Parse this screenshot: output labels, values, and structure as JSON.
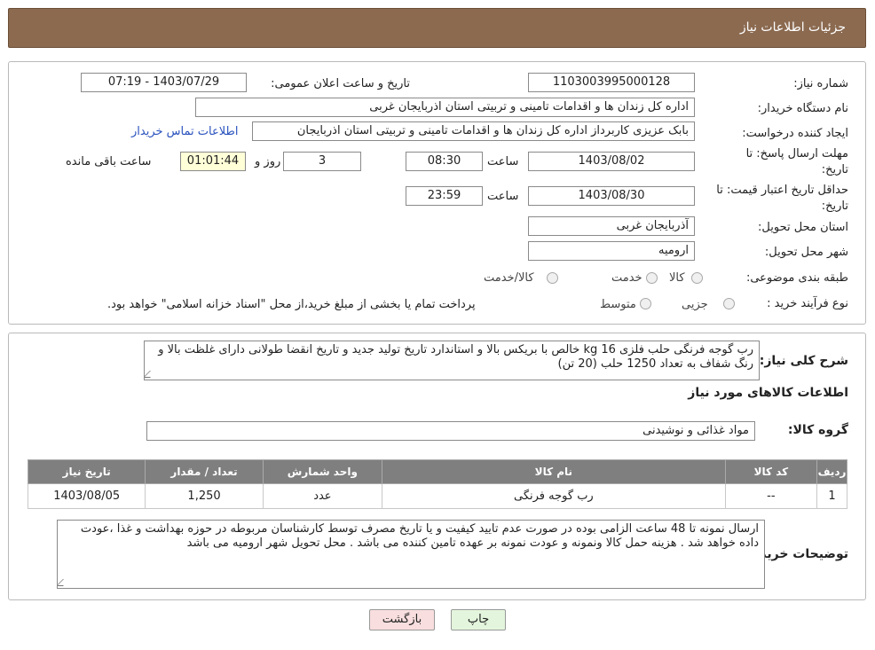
{
  "window": {
    "title": "جزئیات اطلاعات نیاز"
  },
  "form": {
    "need_number_label": "شماره نیاز:",
    "need_number": "1103003995000128",
    "announce_label": "تاریخ و ساعت اعلان عمومی:",
    "announce_value": "1403/07/29 - 07:19",
    "buyer_org_label": "نام دستگاه خریدار:",
    "buyer_org": "اداره کل زندان ها و اقدامات تامینی و تربیتی استان اذربایجان غربی",
    "requester_label": "ایجاد کننده درخواست:",
    "requester": "بابک عزیزی کاربرداز اداره کل زندان ها و اقدامات تامینی و تربیتی استان اذربایجان",
    "contact_link": "اطلاعات تماس خریدار",
    "deadline_label": "مهلت ارسال پاسخ: تا تاریخ:",
    "deadline_date": "1403/08/02",
    "time_label": "ساعت",
    "deadline_time": "08:30",
    "days_value": "3",
    "days_label": "روز و",
    "remaining_time": "01:01:44",
    "remaining_label": "ساعت باقی مانده",
    "validity_label": "حداقل تاریخ اعتبار قیمت: تا تاریخ:",
    "validity_date": "1403/08/30",
    "validity_time": "23:59",
    "province_label": "استان محل تحویل:",
    "province": "آذربایجان غربی",
    "city_label": "شهر محل تحویل:",
    "city": "ارومیه",
    "category_label": "طبقه بندی موضوعی:",
    "category_options": [
      "کالا",
      "خدمت",
      "کالا/خدمت"
    ],
    "process_label": "نوع فرآیند خرید :",
    "process_options": [
      "جزیی",
      "متوسط"
    ],
    "process_note": "پرداخت تمام یا بخشی از مبلغ خرید،از محل \"اسناد خزانه اسلامی\" خواهد بود."
  },
  "details": {
    "summary_label": "شرح کلی نیاز:",
    "summary": "رب گوجه فرنگی حلب فلزی 16 kg خالص با بریکس بالا و استاندارد تاریخ تولید جدید و تاریخ انقضا طولانی دارای غلظت بالا و رنگ شفاف به تعداد 1250 حلب (20 تن)",
    "goods_section_title": "اطلاعات کالاهای مورد نیاز",
    "goods_group_label": "گروه کالا:",
    "goods_group": "مواد غذائی و نوشیدنی",
    "table": {
      "headers": [
        "ردیف",
        "کد کالا",
        "نام کالا",
        "واحد شمارش",
        "تعداد / مقدار",
        "تاریخ نیاز"
      ],
      "rows": [
        [
          "1",
          "--",
          "رب گوجه فرنگی",
          "عدد",
          "1,250",
          "1403/08/05"
        ]
      ]
    },
    "buyer_notes_label": "توضیحات خریدار:",
    "buyer_notes": "ارسال نمونه تا 48  ساعت الزامی بوده در صورت عدم تایید کیفیت و یا تاریخ مصرف توسط کارشناسان مربوطه در حوزه بهداشت و غذا ،عودت داده خواهد شد . هزینه حمل کالا ونمونه و عودت نمونه بر عهده تامین کننده می باشد . محل تحویل شهر ارومیه می باشد"
  },
  "buttons": {
    "back": "بازگشت",
    "print": "چاپ"
  },
  "colors": {
    "titlebar": "#8b6a50",
    "table_header": "#7f7f7f",
    "link": "#2a52be",
    "back_btn": "#f8dede",
    "print_btn": "#e3f5dc"
  }
}
